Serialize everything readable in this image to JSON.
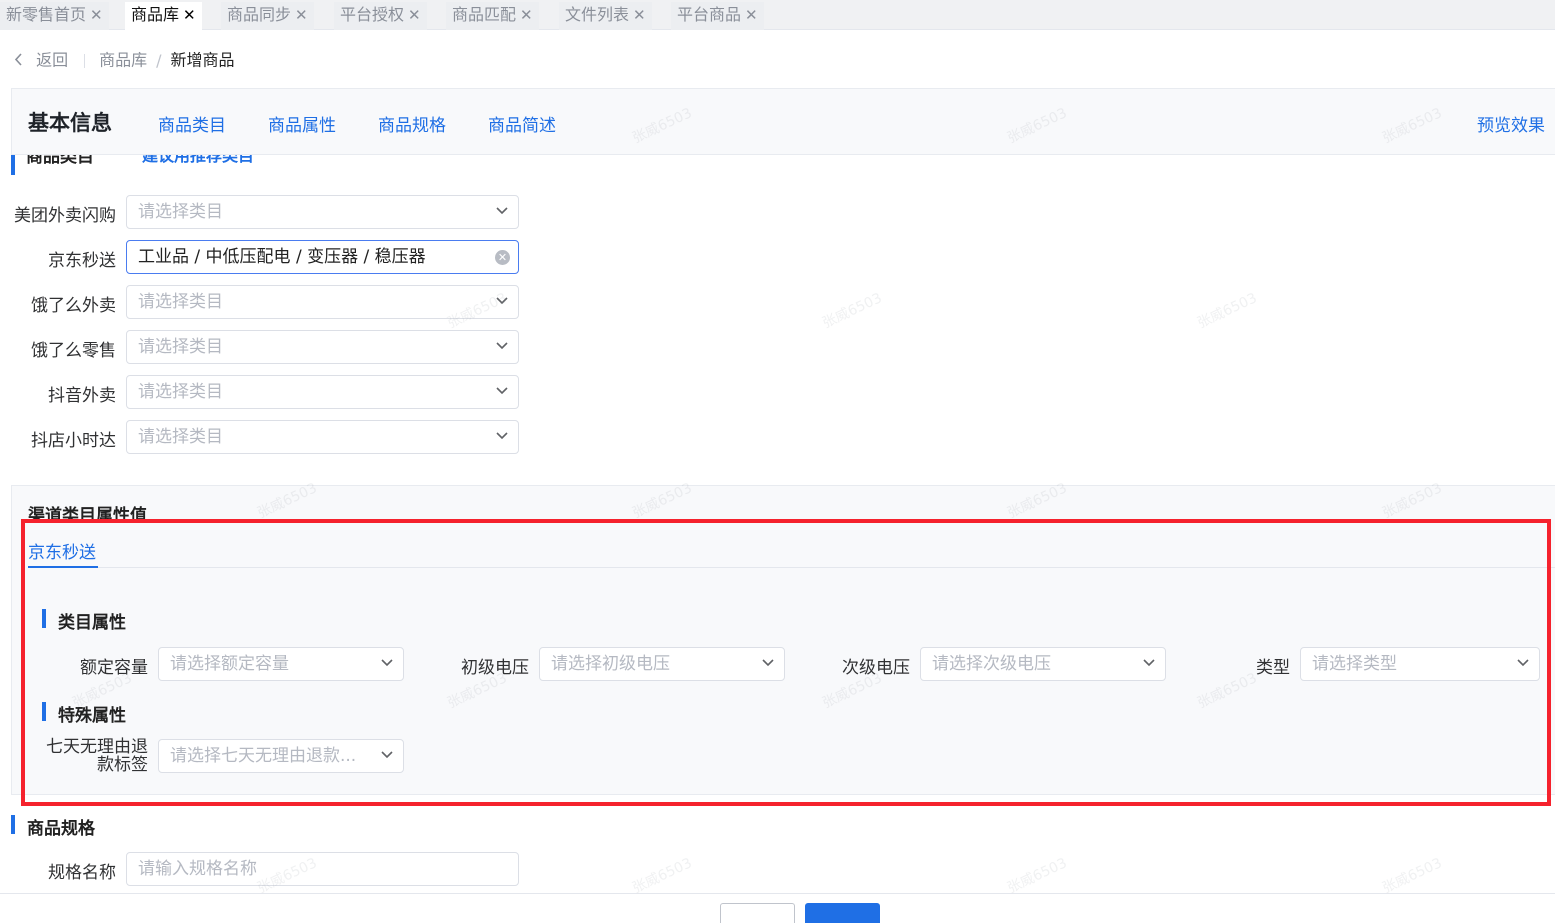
{
  "tabs": [
    {
      "label": "新零售首页",
      "active": false
    },
    {
      "label": "商品库",
      "active": true
    },
    {
      "label": "商品同步",
      "active": false
    },
    {
      "label": "平台授权",
      "active": false
    },
    {
      "label": "商品匹配",
      "active": false
    },
    {
      "label": "文件列表",
      "active": false
    },
    {
      "label": "平台商品",
      "active": false
    }
  ],
  "tab_close": "✕",
  "breadcrumb": {
    "back": "返回",
    "parent": "商品库",
    "separator": "/",
    "current": "新增商品"
  },
  "anchor_nav": {
    "title": "基本信息",
    "items": [
      "商品类目",
      "商品属性",
      "商品规格",
      "商品简述"
    ],
    "preview": "预览效果"
  },
  "category_section": {
    "title": "商品类目",
    "hint": "建议用推荐类目"
  },
  "category_rows": [
    {
      "label": "美团外卖闪购",
      "placeholder": "请选择类目",
      "value": ""
    },
    {
      "label": "京东秒送",
      "placeholder": "请选择类目",
      "value": "工业品 / 中低压配电 / 变压器 / 稳压器"
    },
    {
      "label": "饿了么外卖",
      "placeholder": "请选择类目",
      "value": ""
    },
    {
      "label": "饿了么零售",
      "placeholder": "请选择类目",
      "value": ""
    },
    {
      "label": "抖音外卖",
      "placeholder": "请选择类目",
      "value": ""
    },
    {
      "label": "抖店小时达",
      "placeholder": "请选择类目",
      "value": ""
    }
  ],
  "channel_props": {
    "title": "渠道类目属性值",
    "active_tab": "京东秒送",
    "category_attrs_title": "类目属性",
    "category_attrs": [
      {
        "label": "额定容量",
        "placeholder": "请选择额定容量"
      },
      {
        "label": "初级电压",
        "placeholder": "请选择初级电压"
      },
      {
        "label": "次级电压",
        "placeholder": "请选择次级电压"
      },
      {
        "label": "类型",
        "placeholder": "请选择类型"
      }
    ],
    "special_attrs_title": "特殊属性",
    "special_attrs": [
      {
        "label_line1": "七天无理由退",
        "label_line2": "款标签",
        "placeholder": "请选择七天无理由退款..."
      }
    ]
  },
  "spec_section": {
    "title": "商品规格",
    "name_label": "规格名称",
    "name_placeholder": "请输入规格名称"
  },
  "watermark": "张威6503",
  "colors": {
    "accent": "#1f6fe5",
    "highlight_box": "#f5222d"
  }
}
